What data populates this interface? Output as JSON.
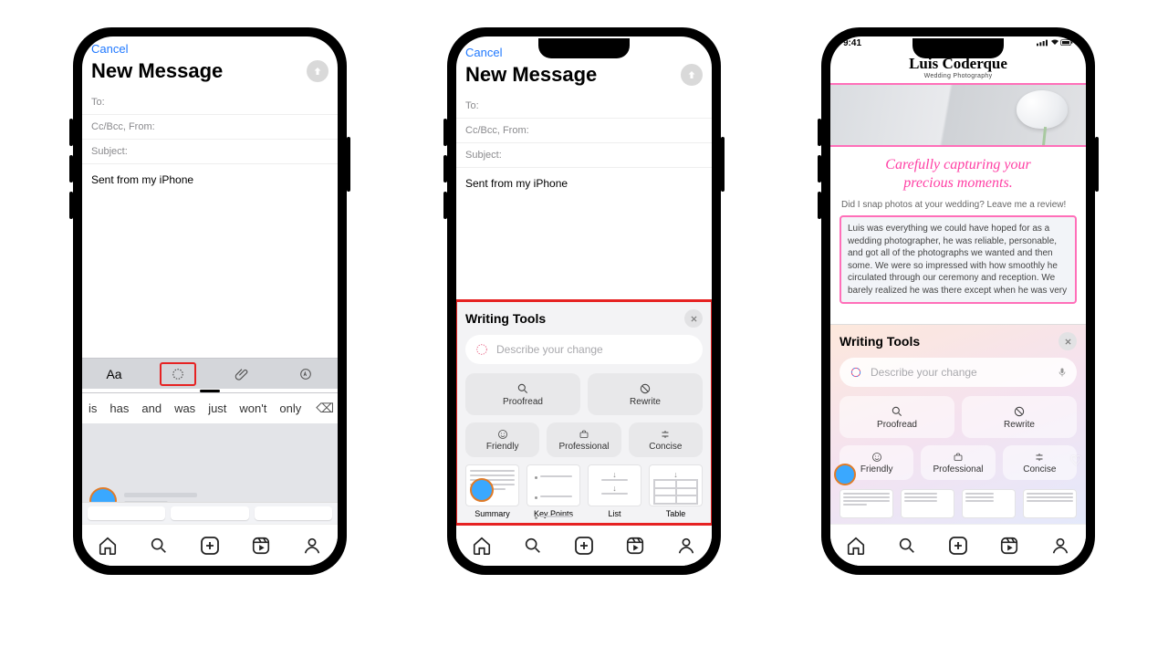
{
  "phone1": {
    "cancel": "Cancel",
    "title": "New Message",
    "to": "To:",
    "ccbcc": "Cc/Bcc, From:",
    "subject": "Subject:",
    "body": "Sent from my iPhone",
    "toolbar": {
      "format": "Aa"
    },
    "suggestions": [
      "is",
      "has",
      "and",
      "was",
      "just",
      "won't",
      "only"
    ]
  },
  "phone2": {
    "cancel": "Cancel",
    "title": "New Message",
    "to": "To:",
    "ccbcc": "Cc/Bcc, From:",
    "subject": "Subject:",
    "body": "Sent from my iPhone",
    "wt": {
      "title": "Writing Tools",
      "placeholder": "Describe your change",
      "proofread": "Proofread",
      "rewrite": "Rewrite",
      "friendly": "Friendly",
      "professional": "Professional",
      "concise": "Concise",
      "summary": "Summary",
      "keypoints": "Key Points",
      "list": "List",
      "table": "Table"
    }
  },
  "phone3": {
    "time": "9:41",
    "brand": "Luis Coderque",
    "sub": "Wedding Photography",
    "tagline1": "Carefully capturing your",
    "tagline2": "precious moments.",
    "prompt": "Did I snap photos at your wedding? Leave me a review!",
    "review": "Luis was everything we could have hoped for as a wedding photographer, he was reliable, personable, and got all of the photographs we wanted and then some. We were so impressed with how smoothly he circulated through our ceremony and reception. We barely realized he was there except when he was very",
    "wt": {
      "title": "Writing Tools",
      "placeholder": "Describe your change",
      "proofread": "Proofread",
      "rewrite": "Rewrite",
      "friendly": "Friendly",
      "professional": "Professional",
      "concise": "Concise"
    }
  }
}
